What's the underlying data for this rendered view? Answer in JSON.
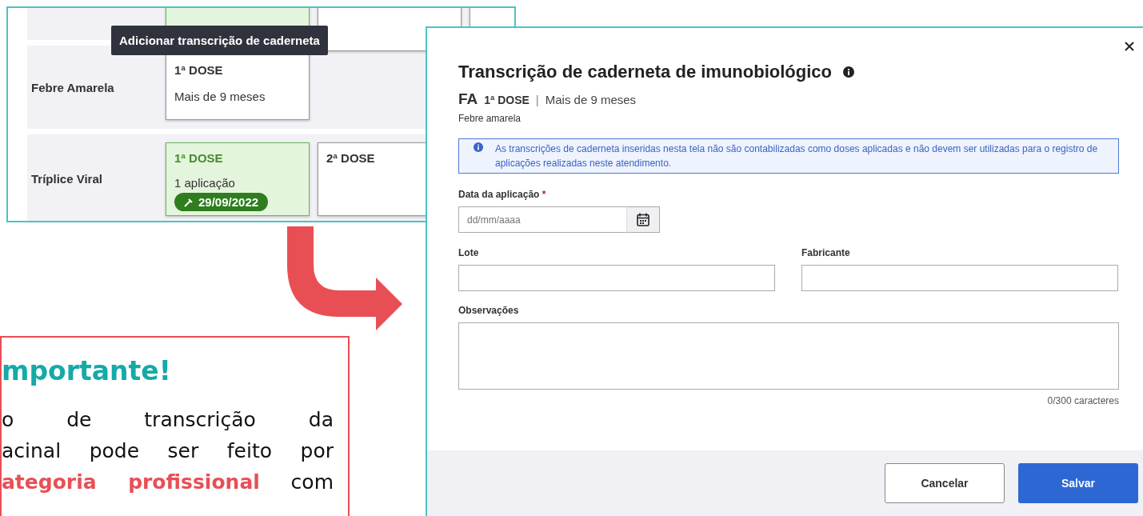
{
  "vaccine_table": {
    "tooltip": "Adicionar transcrição de caderneta",
    "rows": [
      {
        "cards": [
          {
            "applied": true
          },
          {
            "applied": false
          },
          {
            "applied": false
          }
        ]
      },
      {
        "name": "Febre Amarela",
        "cards": [
          {
            "applied": false,
            "dose": "1ª DOSE",
            "detail": "Mais de 9 meses"
          }
        ]
      },
      {
        "name": "Tríplice Viral",
        "cards": [
          {
            "applied": true,
            "dose": "1ª DOSE",
            "detail": "1 aplicação",
            "date": "29/09/2022"
          },
          {
            "applied": false,
            "dose": "2ª DOSE"
          }
        ]
      }
    ]
  },
  "modal": {
    "title": "Transcrição de caderneta de imunobiológico",
    "code": "FA",
    "dose": "1ª DOSE",
    "separator": "|",
    "age": "Mais de 9 meses",
    "vaccine": "Febre amarela",
    "alert": "As transcrições de caderneta inseridas nesta tela não são contabilizadas como doses aplicadas e não devem ser utilizadas para o registro de aplicações realizadas neste atendimento.",
    "fields": [
      {
        "kind": "date",
        "label": "Data da aplicação",
        "required_mark": "*",
        "placeholder": "dd/mm/aaaa"
      },
      {
        "kind": "text",
        "label": "Lote"
      },
      {
        "kind": "text",
        "label": "Fabricante"
      },
      {
        "kind": "textarea",
        "label": "Observações",
        "counter": "0/300 caracteres"
      }
    ],
    "buttons": [
      {
        "kind": "secondary",
        "label": "Cancelar"
      },
      {
        "kind": "primary",
        "label": "Salvar"
      }
    ]
  },
  "note": {
    "title": "mportante!",
    "lines": [
      "o de transcrição da",
      "acinal pode ser feito por",
      "**ategoria profissional** com"
    ]
  }
}
